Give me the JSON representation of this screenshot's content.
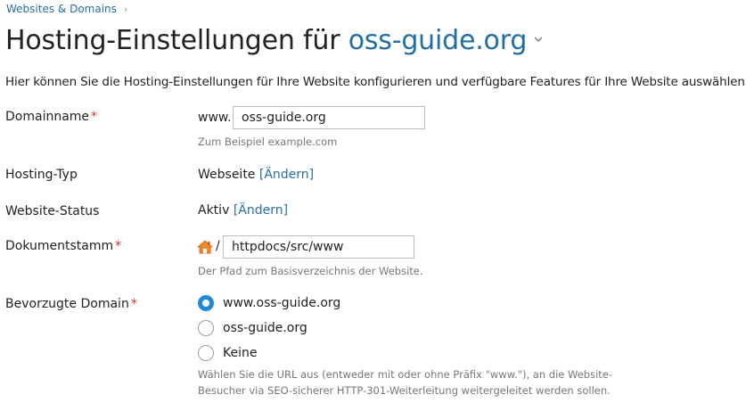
{
  "breadcrumb": {
    "label": "Websites & Domains",
    "chevron": "›"
  },
  "title": {
    "text": "Hosting-Einstellungen für",
    "domain": "oss-guide.org",
    "caret": "⌄"
  },
  "intro": "Hier können Sie die Hosting-Einstellungen für Ihre Website konfigurieren und verfügbare Features für Ihre Website auswählen.",
  "required_marker": "*",
  "domain_name": {
    "label": "Domainname",
    "prefix": "www.",
    "value": "oss-guide.org",
    "hint": "Zum Beispiel example.com"
  },
  "hosting_type": {
    "label": "Hosting-Typ",
    "value": "Webseite",
    "change_link": "[Ändern]"
  },
  "website_status": {
    "label": "Website-Status",
    "value": "Aktiv",
    "change_link": "[Ändern]"
  },
  "document_root": {
    "label": "Dokumentstamm",
    "icon": "home-icon",
    "separator": "/",
    "value": "httpdocs/src/www",
    "hint": "Der Pfad zum Basisverzeichnis der Website."
  },
  "preferred_domain": {
    "label": "Bevorzugte Domain",
    "options": [
      {
        "label": "www.oss-guide.org",
        "checked": true
      },
      {
        "label": "oss-guide.org",
        "checked": false
      },
      {
        "label": "Keine",
        "checked": false
      }
    ],
    "hint_line1": "Wählen Sie die URL aus (entweder mit oder ohne Präfix \"www.\"), an die Website-",
    "hint_line2": "Besucher via SEO-sicherer HTTP-301-Weiterleitung weitergeleitet werden sollen."
  },
  "colors": {
    "link": "#2a6fa5",
    "required": "#d0322f",
    "radio_active": "#1e8ad8"
  }
}
